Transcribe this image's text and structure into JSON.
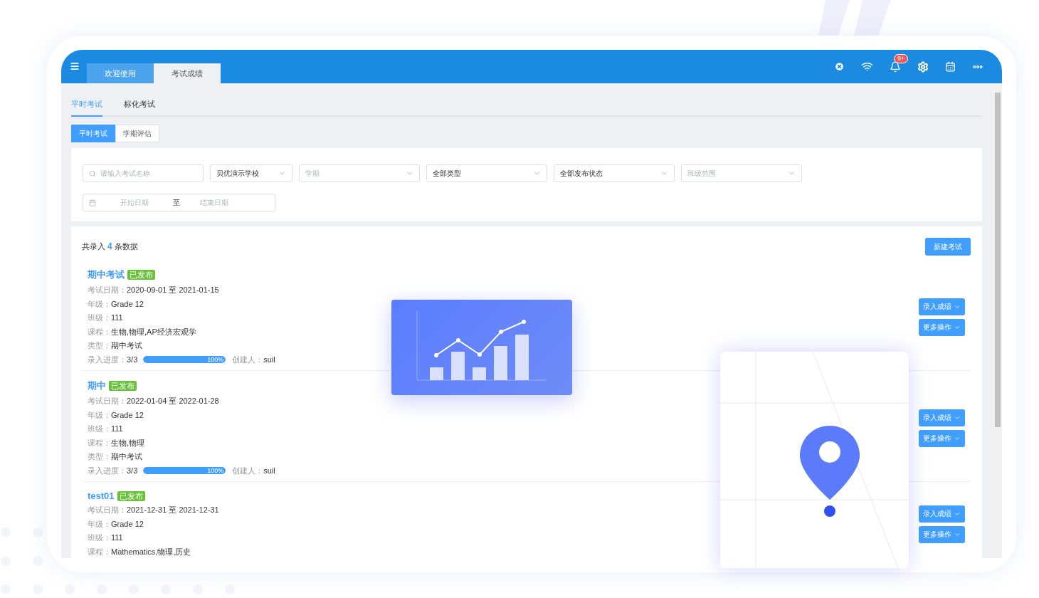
{
  "header": {
    "tabs": [
      {
        "label": "欢迎使用",
        "selected": false
      },
      {
        "label": "考试成绩",
        "selected": true
      }
    ],
    "notification_badge": "9+"
  },
  "page_tabs": [
    {
      "label": "平时考试",
      "selected": true
    },
    {
      "label": "标化考试",
      "selected": false
    }
  ],
  "segments": [
    {
      "label": "平时考试",
      "selected": true
    },
    {
      "label": "学期评估",
      "selected": false
    }
  ],
  "filters": {
    "search": {
      "placeholder": "请输入考试名称"
    },
    "selects": [
      {
        "value": "贝优演示学校"
      },
      {
        "placeholder": "学期"
      },
      {
        "value": "全部类型"
      },
      {
        "value": "全部发布状态"
      },
      {
        "placeholder": "班级范围"
      }
    ],
    "date_range": {
      "start_placeholder": "开始日期",
      "separator": "至",
      "end_placeholder": "结束日期"
    }
  },
  "summary": {
    "prefix": "共录入",
    "count": "4",
    "suffix": "条数据"
  },
  "new_button": "新建考试",
  "exams": [
    {
      "title": "期中考试",
      "status": "已发布",
      "fields": [
        {
          "label": "考试日期：",
          "value": "2020-09-01 至 2021-01-15"
        },
        {
          "label": "年级：",
          "value": "Grade 12"
        },
        {
          "label": "班级：",
          "value": "111"
        },
        {
          "label": "课程：",
          "value": "生物,物理,AP经济宏观学"
        },
        {
          "label": "类型：",
          "value": "期中考试"
        }
      ],
      "progress": {
        "label": "录入进度：",
        "value": "3/3",
        "level": 1,
        "percent": "100%"
      },
      "creator": {
        "label": "创建人：",
        "value": "suil"
      },
      "actions": [
        "录入成绩",
        "更多操作"
      ]
    },
    {
      "title": "期中",
      "status": "已发布",
      "fields": [
        {
          "label": "考试日期：",
          "value": "2022-01-04 至 2022-01-28"
        },
        {
          "label": "年级：",
          "value": "Grade 12"
        },
        {
          "label": "班级：",
          "value": "111"
        },
        {
          "label": "课程：",
          "value": "生物,物理"
        },
        {
          "label": "类型：",
          "value": "期中考试"
        }
      ],
      "progress": {
        "label": "录入进度：",
        "value": "3/3",
        "level": 1,
        "percent": "100%"
      },
      "creator": {
        "label": "创建人：",
        "value": "suil"
      },
      "actions": [
        "录入成绩",
        "更多操作"
      ]
    },
    {
      "title": "test01",
      "status": "已发布",
      "fields": [
        {
          "label": "考试日期：",
          "value": "2021-12-31 至 2021-12-31"
        },
        {
          "label": "年级：",
          "value": "Grade 12"
        },
        {
          "label": "班级：",
          "value": "111"
        },
        {
          "label": "课程：",
          "value": "Mathematics,物理,历史"
        }
      ],
      "actions": [
        "录入成绩",
        "更多操作"
      ]
    }
  ]
}
